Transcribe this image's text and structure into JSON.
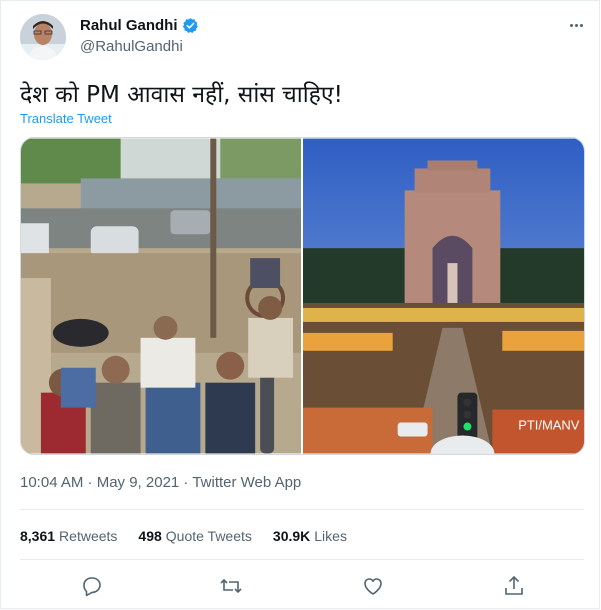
{
  "user": {
    "name": "Rahul Gandhi",
    "handle": "@RahulGandhi"
  },
  "tweet": {
    "text": "देश को PM आवास नहीं, सांस चाहिए!",
    "translate_label": "Translate Tweet",
    "meta": "10:04 AM · May 9, 2021 · Twitter Web App"
  },
  "media": {
    "right_watermark": "PTI/MANV"
  },
  "stats": [
    {
      "count": "8,361",
      "label": "Retweets"
    },
    {
      "count": "498",
      "label": "Quote Tweets"
    },
    {
      "count": "30.9K",
      "label": "Likes"
    }
  ],
  "actions": [
    "reply-icon",
    "retweet-icon",
    "like-icon",
    "share-icon"
  ],
  "colors": {
    "accent": "#1d9bf0",
    "text": "#0f1419",
    "secondary": "#536471",
    "border": "#e6ecf0"
  }
}
